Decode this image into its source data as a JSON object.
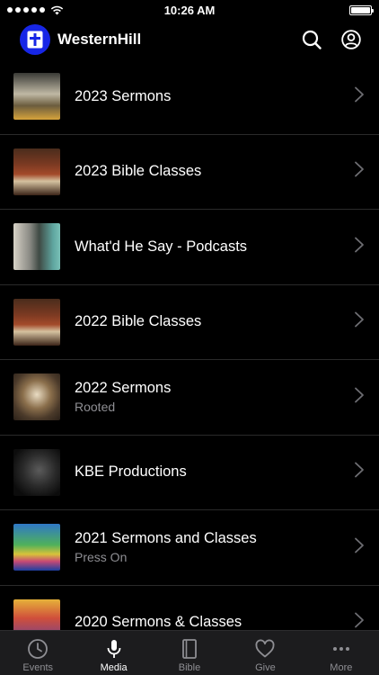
{
  "status": {
    "time": "10:26 AM"
  },
  "header": {
    "title": "WesternHill"
  },
  "items": [
    {
      "title": "2023 Sermons",
      "subtitle": "",
      "thumb": "t-trust"
    },
    {
      "title": "2023 Bible Classes",
      "subtitle": "",
      "thumb": "t-bible"
    },
    {
      "title": "What'd He Say - Podcasts",
      "subtitle": "",
      "thumb": "t-pod"
    },
    {
      "title": "2022 Bible Classes",
      "subtitle": "",
      "thumb": "t-bible"
    },
    {
      "title": "2022 Sermons",
      "subtitle": "Rooted",
      "thumb": "t-rooted"
    },
    {
      "title": "KBE Productions",
      "subtitle": "",
      "thumb": "t-kbe"
    },
    {
      "title": "2021 Sermons and Classes",
      "subtitle": "Press On",
      "thumb": "t-press"
    },
    {
      "title": "2020 Sermons & Classes",
      "subtitle": "",
      "thumb": "t-joy"
    }
  ],
  "tabs": [
    {
      "label": "Events",
      "icon": "clock-icon",
      "active": false
    },
    {
      "label": "Media",
      "icon": "microphone-icon",
      "active": true
    },
    {
      "label": "Bible",
      "icon": "book-icon",
      "active": false
    },
    {
      "label": "Give",
      "icon": "heart-icon",
      "active": false
    },
    {
      "label": "More",
      "icon": "ellipsis-icon",
      "active": false
    }
  ],
  "colors": {
    "accent": "#1726e6",
    "background": "#000000",
    "tabbar": "#1c1c1e",
    "inactive": "#8e8e93"
  }
}
